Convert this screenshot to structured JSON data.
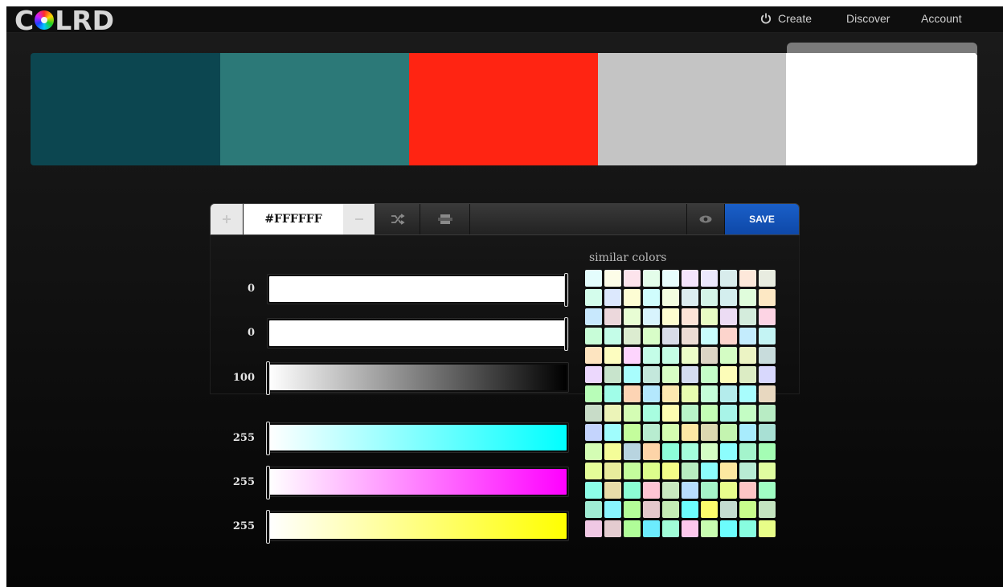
{
  "header": {
    "logo_text_left": "C",
    "logo_text_right": "LRD",
    "nav": [
      {
        "label": "Create",
        "icon": "power-icon"
      },
      {
        "label": "Discover"
      },
      {
        "label": "Account"
      }
    ]
  },
  "palette": {
    "swatches": [
      "#0c4650",
      "#2c7978",
      "#ff2412",
      "#c4c4c4",
      "#ffffff"
    ],
    "selected_index": 4
  },
  "toolbar": {
    "hex_value": "#FFFFFF",
    "add_icon": "plus-icon",
    "remove_icon": "minus-icon",
    "shuffle_icon": "shuffle-icon",
    "swap_icon": "swap-icon",
    "preview_icon": "eye-icon",
    "save_label": "SAVE"
  },
  "sliders": {
    "hsb": [
      {
        "label": "0",
        "value": 0,
        "gradient": [
          "#ffffff",
          "#ffffff"
        ]
      },
      {
        "label": "0",
        "value": 0,
        "gradient": [
          "#ffffff",
          "#ffffff"
        ]
      },
      {
        "label": "100",
        "value": 100,
        "gradient": [
          "#ffffff",
          "#000000"
        ]
      }
    ],
    "rgb": [
      {
        "label": "255",
        "value": 255,
        "gradient": [
          "#ffffff",
          "#00ffff"
        ]
      },
      {
        "label": "255",
        "value": 255,
        "gradient": [
          "#ffffff",
          "#ff00ff"
        ]
      },
      {
        "label": "255",
        "value": 255,
        "gradient": [
          "#ffffff",
          "#ffff00"
        ]
      }
    ]
  },
  "similar": {
    "title": "similar colors",
    "colors": [
      "#e4fdfd",
      "#fdfde8",
      "#fde4ec",
      "#e4fdea",
      "#e8fdfd",
      "#f5e4fd",
      "#ece8fd",
      "#d8ecec",
      "#fde8da",
      "#e8ece0",
      "#d4fdec",
      "#dce8fd",
      "#fdfdd4",
      "#d0fdfd",
      "#f4fde0",
      "#dcecf0",
      "#d4f4e8",
      "#d4eeee",
      "#e0fddc",
      "#fde8c4",
      "#c8e8fd",
      "#ecd8dc",
      "#e8fdd4",
      "#d8f4fd",
      "#fdfdd0",
      "#fde4d8",
      "#e8fdc4",
      "#ecdcf4",
      "#d4ecdc",
      "#fdd4e4",
      "#c8fdd8",
      "#c4fde8",
      "#dcecd0",
      "#d8fdc8",
      "#d8dce8",
      "#ecdcd4",
      "#c8fdfd",
      "#fdd4cc",
      "#c4ecfd",
      "#c4f4f4",
      "#fde4c0",
      "#fdfdc0",
      "#fdd4fd",
      "#c4fde8",
      "#c4fde4",
      "#ecfdc8",
      "#dcd4c4",
      "#d4fdc4",
      "#ecf4c4",
      "#c8dcdc",
      "#ecd8fd",
      "#c8e4cc",
      "#a8fdfd",
      "#c4e8dc",
      "#d8fdc4",
      "#d4dcf0",
      "#c4fdc8",
      "#fdfdb8",
      "#dcecc4",
      "#d8d8fd",
      "#b8fdb8",
      "#a0fde8",
      "#fdd4b4",
      "#b4e8fd",
      "#fde8b0",
      "#e8fdb0",
      "#c4fdd8",
      "#b4ecec",
      "#a8fdfd",
      "#e8d8c0",
      "#c8dcc8",
      "#ecf4b8",
      "#d4fdb4",
      "#a8fde0",
      "#fdfdb0",
      "#b8f4c8",
      "#c4fdb4",
      "#a8f4e8",
      "#c4fdc4",
      "#b8ecc4",
      "#c4d4fd",
      "#a0fdfd",
      "#c4fd9c",
      "#b8ecd0",
      "#d4fdb0",
      "#fde8a4",
      "#dcd8b0",
      "#c4f4b0",
      "#a8ecfd",
      "#a8e0d4",
      "#d4fdb4",
      "#f4fd98",
      "#b8d4e0",
      "#fdd4a8",
      "#8cfdd8",
      "#a4fddc",
      "#d4fdc4",
      "#8cfdfd",
      "#a4f4cc",
      "#a4fdb4",
      "#e4fd98",
      "#e8ec9c",
      "#c4fd9c",
      "#dcfd8c",
      "#f4fd88",
      "#b8ecc0",
      "#8cfdfd",
      "#fde8a0",
      "#b8ecd4",
      "#e0fda0",
      "#8cfde8",
      "#e8dca8",
      "#8cfdd4",
      "#fdc4d4",
      "#c8e8c0",
      "#b8dcfd",
      "#a4f4c8",
      "#e8fd8c",
      "#fdc4c4",
      "#a0fdc4",
      "#a0ecd4",
      "#88f4fd",
      "#b4fd98",
      "#e4c8cc",
      "#c4ecb4",
      "#6cfdfd",
      "#fdfd6c",
      "#c4dcd0",
      "#c8fd8c",
      "#c4e4c0",
      "#f0c8e4",
      "#e4ccd0",
      "#b0fd98",
      "#6cecfd",
      "#a0fdd8",
      "#fdc8ec",
      "#c8fdb0",
      "#6cfdfd",
      "#88fde0",
      "#e8fd88"
    ]
  }
}
